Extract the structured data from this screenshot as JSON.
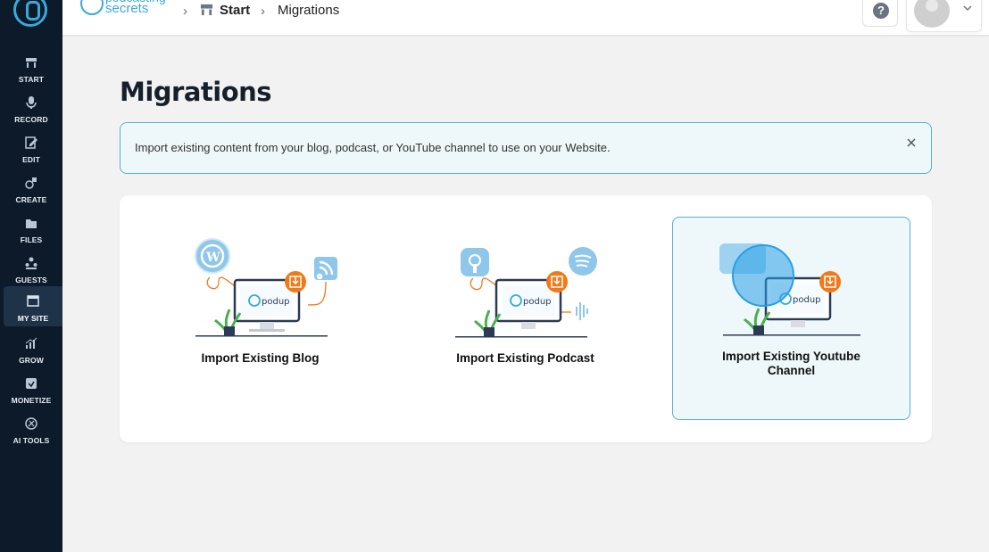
{
  "sidebar": {
    "items": [
      {
        "label": "START",
        "icon": "start-icon"
      },
      {
        "label": "RECORD",
        "icon": "microphone-icon"
      },
      {
        "label": "EDIT",
        "icon": "edit-icon"
      },
      {
        "label": "CREATE",
        "icon": "create-icon"
      },
      {
        "label": "FILES",
        "icon": "files-icon"
      },
      {
        "label": "GUESTS",
        "icon": "guests-icon"
      },
      {
        "label": "MY SITE",
        "icon": "my-site-icon",
        "active": true
      },
      {
        "label": "GROW",
        "icon": "grow-icon"
      },
      {
        "label": "MONETIZE",
        "icon": "monetize-icon"
      },
      {
        "label": "AI TOOLS",
        "icon": "ai-tools-icon"
      }
    ]
  },
  "header": {
    "brand_line1": "podcasting",
    "brand_line2": "secrets",
    "breadcrumb": {
      "start": "Start",
      "current": "Migrations"
    },
    "help_label": "?"
  },
  "main": {
    "title": "Migrations",
    "banner_text": "Import existing content from your blog, podcast, or YouTube channel to use on your Website.",
    "options": [
      {
        "label": "Import Existing Blog"
      },
      {
        "label": "Import Existing Podcast"
      },
      {
        "label": "Import Existing Youtube Channel",
        "selected": true
      }
    ],
    "illustration_brand": "podup"
  },
  "colors": {
    "sidebar_bg": "#0c1a2a",
    "accent": "#3aa9d9",
    "selected_border": "#54b3cc",
    "orange": "#f07a1a"
  }
}
